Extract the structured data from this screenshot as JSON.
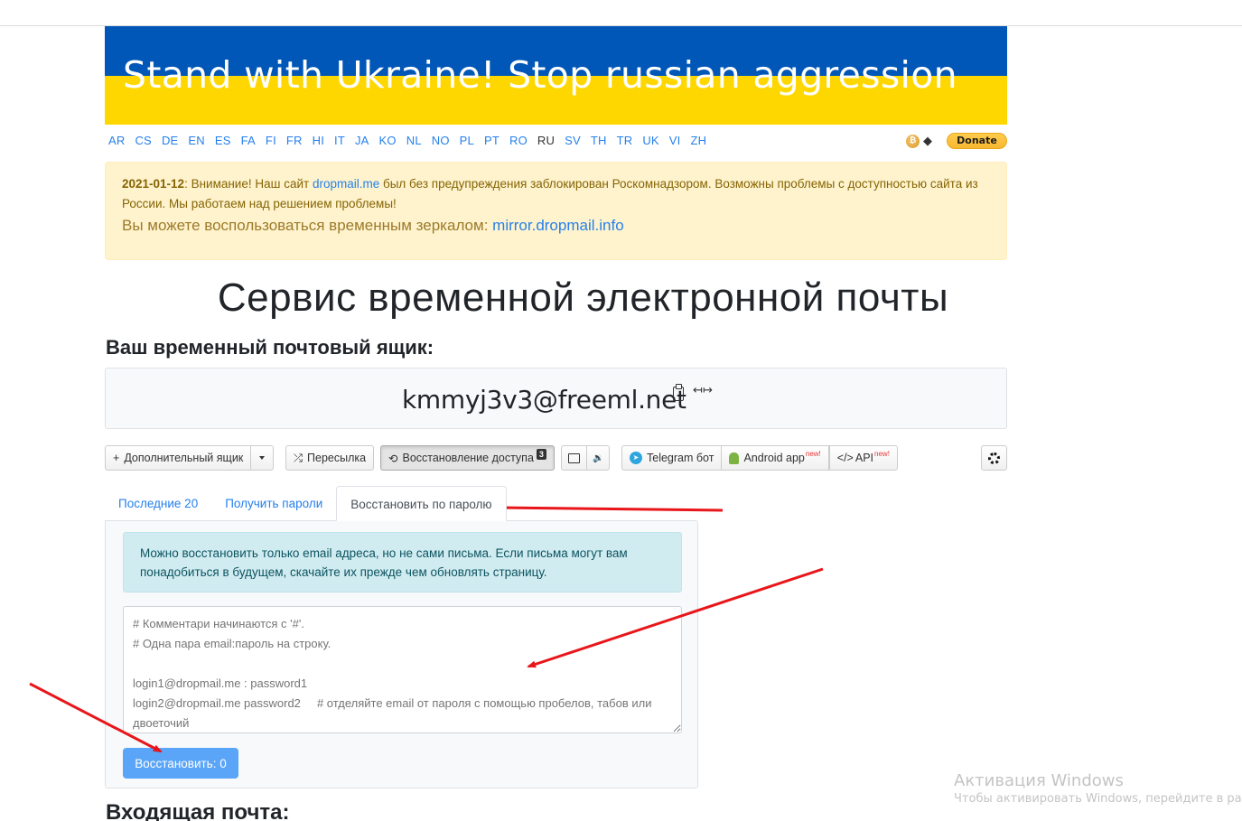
{
  "banner": {
    "text": "Stand with Ukraine! Stop russian aggression",
    "colors": {
      "top": "#0057b8",
      "bottom": "#ffd700"
    }
  },
  "languages": {
    "items": [
      "AR",
      "CS",
      "DE",
      "EN",
      "ES",
      "FA",
      "FI",
      "FR",
      "HI",
      "IT",
      "JA",
      "KO",
      "NL",
      "NO",
      "PL",
      "PT",
      "RO",
      "RU",
      "SV",
      "TH",
      "TR",
      "UK",
      "VI",
      "ZH"
    ],
    "active": "RU"
  },
  "crypto": {
    "btc_icon": "bitcoin-icon",
    "eth_icon": "ethereum-icon",
    "donate_label": "Donate"
  },
  "notice": {
    "date": "2021-01-12",
    "part1": ": Внимание! Наш сайт ",
    "link1": "dropmail.me",
    "part2": " был без предупреждения заблокирован Роскомнадзором. Возможны проблемы с доступностью сайта из России. Мы работаем над решением проблемы!",
    "mirror_text": "Вы можете воспользоваться временным зеркалом: ",
    "mirror_link": "mirror.dropmail.info"
  },
  "header": {
    "title": "Сервис временной электронной почты",
    "mailbox_label": "Ваш временный почтовый ящик:"
  },
  "mailbox": {
    "address": "kmmyj3v3@freeml.net",
    "copy_icon": "clipboard-icon",
    "resize_icon": "arrows-horizontal-icon"
  },
  "toolbar": {
    "add_mailbox": "Дополнительный ящик",
    "forward": "Пересылка",
    "restore_access": "Восстановление доступа",
    "restore_badge": "3",
    "telegram": "Telegram бот",
    "android": "Android app",
    "api": "API",
    "new_label": "new!",
    "plus_glyph": "+",
    "shuffle_glyph": "⤮",
    "refresh_glyph": "⟲",
    "sound_glyph": "🔉",
    "code_glyph": "</>"
  },
  "tabs": [
    {
      "label": "Последние 20",
      "active": false
    },
    {
      "label": "Получить пароли",
      "active": false
    },
    {
      "label": "Восстановить по паролю",
      "active": true
    }
  ],
  "restore": {
    "info": "Можно восстановить только email адреса, но не сами письма. Если письма могут вам понадобиться в будущем, скачайте их прежде чем обновлять страницу.",
    "textarea_placeholder": "# Комментари начинаются с '#'.\n# Одна пара email:пароль на строку.\n\nlogin1@dropmail.me : password1\nlogin2@dropmail.me password2     # отделяйте email от пароля с помощью пробелов, табов или двоеточий",
    "button_label": "Восстановить: 0"
  },
  "inbox": {
    "title": "Входящая почта:"
  },
  "windows_watermark": {
    "title": "Активация Windows",
    "subtitle": "Чтобы активировать Windows, перейдите в ра"
  },
  "annotations": {
    "arrow_color": "#e8161a"
  }
}
